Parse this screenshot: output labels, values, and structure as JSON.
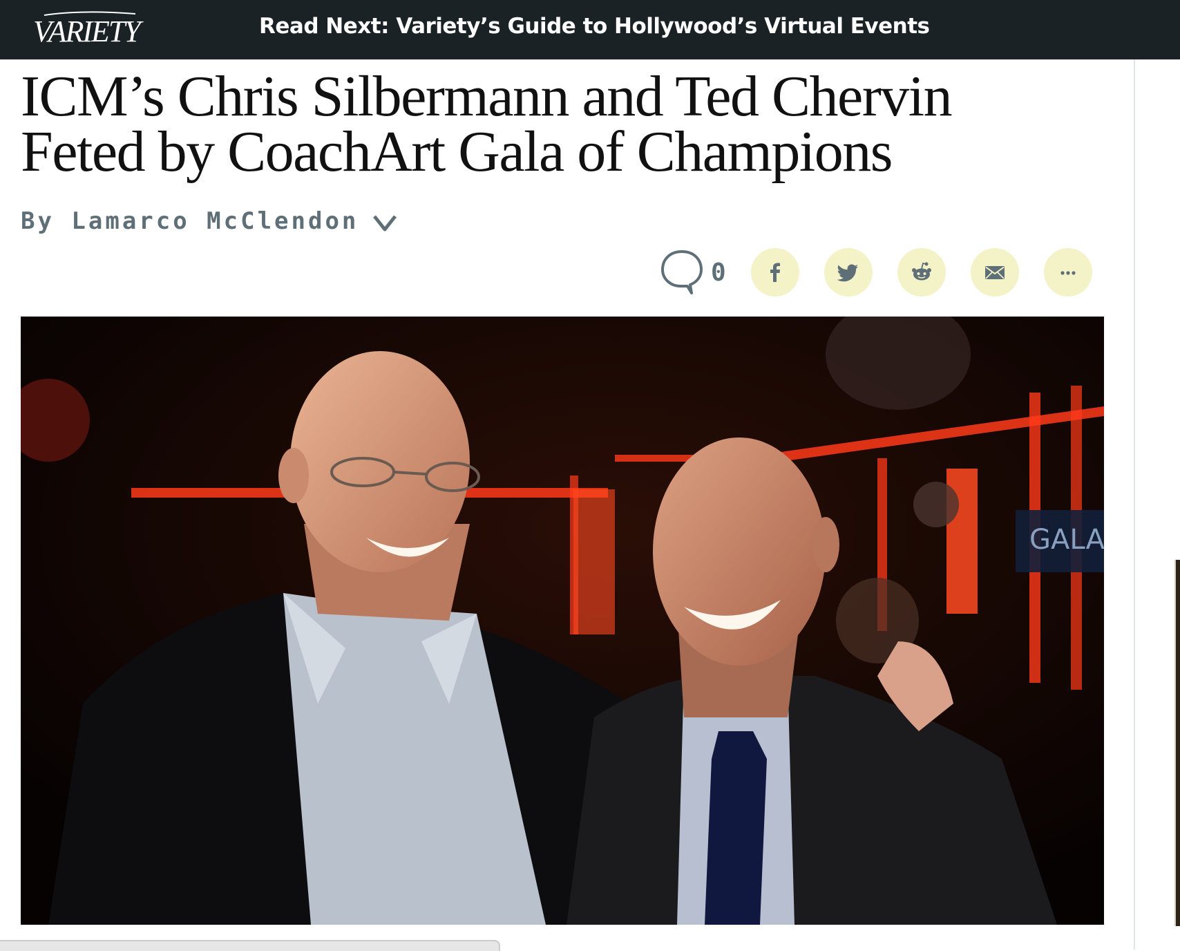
{
  "header": {
    "logo_text": "VARIETY",
    "read_next": "Read Next: Variety’s Guide to Hollywood’s Virtual Events"
  },
  "article": {
    "headline_line1": "ICM’s Chris Silbermann and Ted Chervin",
    "headline_line2": "Feted by CoachArt Gala of Champions",
    "byline": "By Lamarco McClendon"
  },
  "share": {
    "comment_count": "0",
    "buttons": [
      {
        "icon": "facebook-icon"
      },
      {
        "icon": "twitter-icon"
      },
      {
        "icon": "reddit-icon"
      },
      {
        "icon": "email-icon"
      },
      {
        "icon": "more-icon"
      }
    ]
  },
  "photo": {
    "sign_text": "GALA"
  },
  "colors": {
    "topbar_bg": "#1a2226",
    "share_button_bg": "#f4f2c7",
    "byline": "#5e6f78"
  }
}
